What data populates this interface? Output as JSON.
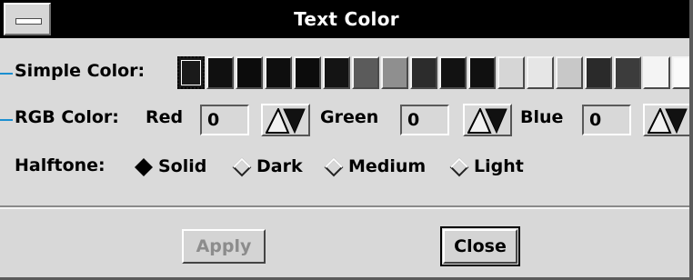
{
  "window": {
    "title": "Text Color"
  },
  "simple_color": {
    "label": "Simple Color:",
    "swatches": [
      "#1a1a1a",
      "#101010",
      "#0c0c0c",
      "#0e0e0e",
      "#0c0c0c",
      "#141414",
      "#5b5b5b",
      "#8f8f8f",
      "#2c2c2c",
      "#121212",
      "#101010",
      "#d6d6d6",
      "#e6e6e6",
      "#c8c8c8",
      "#2a2a2a",
      "#3c3c3c",
      "#f4f4f4",
      "#fafafa"
    ]
  },
  "rgb_color": {
    "label": "RGB Color:",
    "red_label": "Red",
    "red_value": "0",
    "green_label": "Green",
    "green_value": "0",
    "blue_label": "Blue",
    "blue_value": "0"
  },
  "halftone": {
    "label": "Halftone:",
    "options": [
      "Solid",
      "Dark",
      "Medium",
      "Light"
    ],
    "selected": "Solid"
  },
  "buttons": {
    "apply": "Apply",
    "close": "Close"
  }
}
